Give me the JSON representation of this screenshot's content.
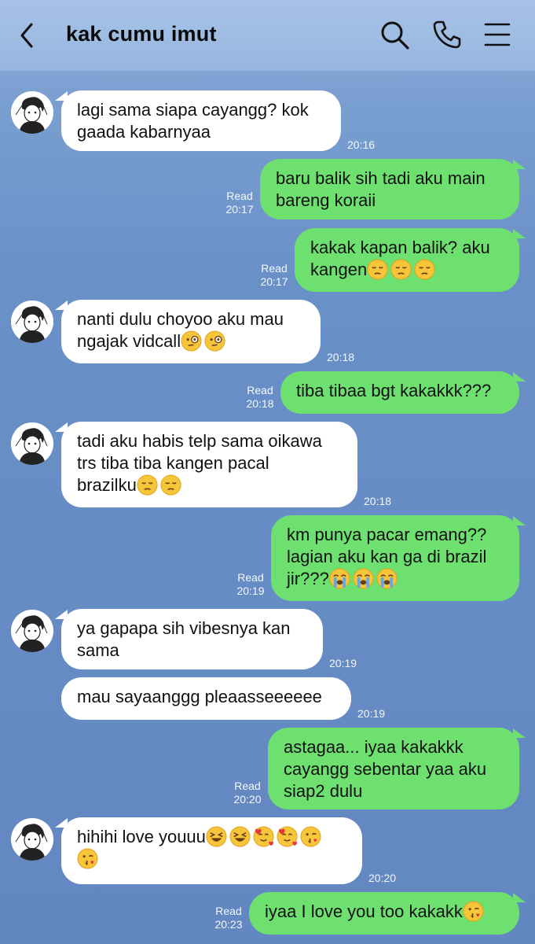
{
  "header": {
    "title": "kak cumu imut",
    "back_icon": "chevron-left-icon",
    "search_icon": "search-icon",
    "call_icon": "phone-icon",
    "menu_icon": "hamburger-menu-icon"
  },
  "colors": {
    "background": "#6287c1",
    "outgoing_bubble": "#6de06f",
    "incoming_bubble": "#ffffff",
    "meta_text": "#f4f7fc"
  },
  "messages": [
    {
      "dir": "in",
      "text": "lagi sama siapa cayangg? kok\ngaada kabarnyaa",
      "time": "20:16",
      "avatar": true
    },
    {
      "dir": "out",
      "text": "baru balik sih tadi aku main\nbareng koraii",
      "time": "20:17",
      "status": "Read"
    },
    {
      "dir": "out",
      "text": "kakak kapan balik? aku\nkangen",
      "emoji": [
        "pensive",
        "pensive",
        "pensive"
      ],
      "time": "20:17",
      "status": "Read"
    },
    {
      "dir": "in",
      "text": "nanti dulu choyoo aku mau\nngajak vidcall",
      "emoji": [
        "monocle",
        "monocle"
      ],
      "time": "20:18",
      "avatar": true
    },
    {
      "dir": "out",
      "text": "tiba tibaa bgt kakakkk???",
      "time": "20:18",
      "status": "Read"
    },
    {
      "dir": "in",
      "text": "tadi aku habis telp sama oikawa\ntrs tiba tiba kangen pacal\nbrazilku",
      "emoji": [
        "pensive",
        "pensive"
      ],
      "time": "20:18",
      "avatar": true
    },
    {
      "dir": "out",
      "text": "km punya pacar emang??\nlagian aku kan ga di brazil\njir???",
      "emoji": [
        "sob",
        "sob",
        "sob"
      ],
      "time": "20:19",
      "status": "Read"
    },
    {
      "dir": "in",
      "text": "ya gapapa sih vibesnya kan\nsama",
      "time": "20:19",
      "avatar": true
    },
    {
      "dir": "in",
      "text": "mau sayaanggg pleaasseeeeee",
      "time": "20:19",
      "avatar": false
    },
    {
      "dir": "out",
      "text": "astagaa... iyaa kakakkk\ncayangg sebentar yaa aku\nsiap2 dulu",
      "time": "20:20",
      "status": "Read"
    },
    {
      "dir": "in",
      "text": "hihihi love youuu",
      "emoji": [
        "laughing",
        "laughing",
        "hearts",
        "hearts",
        "kiss",
        "kiss"
      ],
      "time": "20:20",
      "avatar": true
    },
    {
      "dir": "out",
      "text": "iyaa I love you too kakakk",
      "emoji": [
        "kiss"
      ],
      "time": "20:23",
      "status": "Read"
    }
  ]
}
